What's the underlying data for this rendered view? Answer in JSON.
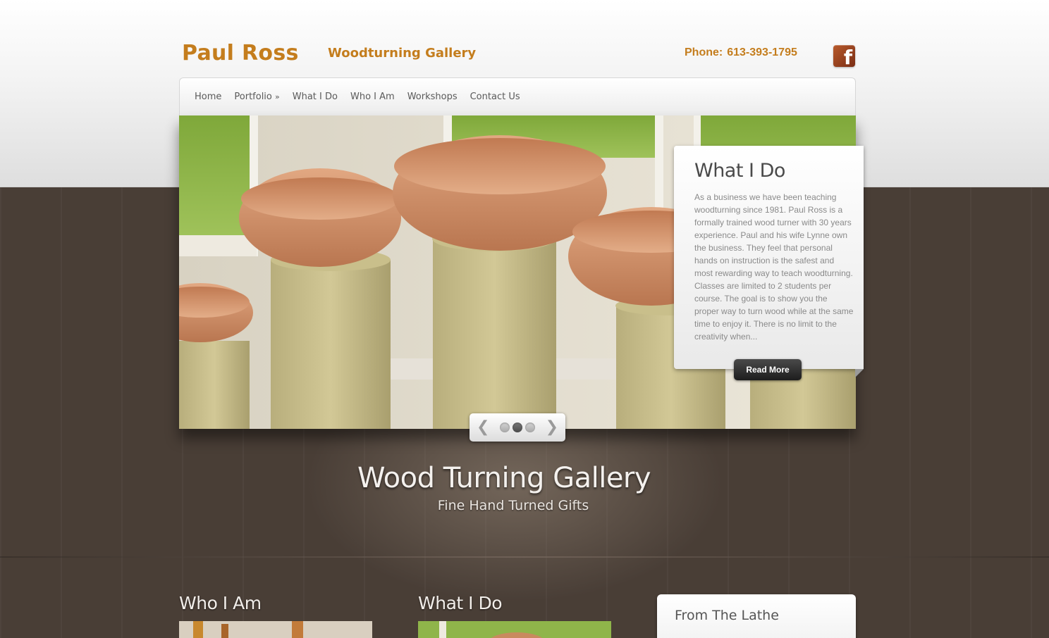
{
  "header": {
    "brand": "Paul Ross",
    "tagline": "Woodturning Gallery",
    "phone_label": "Phone:",
    "phone_number": "613-393-1795",
    "facebook_icon": "facebook-icon"
  },
  "nav": {
    "items": [
      {
        "label": "Home"
      },
      {
        "label": "Portfolio",
        "suffix": "»"
      },
      {
        "label": "What I Do"
      },
      {
        "label": "Who I Am"
      },
      {
        "label": "Workshops"
      },
      {
        "label": "Contact Us"
      }
    ]
  },
  "slider": {
    "card_title": "What I Do",
    "card_text": "As a business we have been teaching woodturning since 1981. Paul Ross is a formally trained wood turner with 30 years experience. Paul and his wife Lynne own the business. They feel that personal hands on instruction is the safest and most rewarding way to teach woodturning. Classes are limited to 2 students per course. The goal is to show you the proper way to turn wood while at the same time to enjoy it.  There is no limit to the creativity when...",
    "read_more": "Read More",
    "prev_icon": "chevron-left-icon",
    "next_icon": "chevron-right-icon",
    "dots": 3,
    "active_dot": 2
  },
  "hero": {
    "title": "Wood Turning Gallery",
    "subtitle": "Fine Hand Turned Gifts"
  },
  "columns": [
    {
      "title": "Who I Am"
    },
    {
      "title": "What I Do"
    }
  ],
  "sidebar": {
    "title": "From The Lathe"
  },
  "colors": {
    "brand": "#c47d1d",
    "wood": "#4b4038"
  }
}
